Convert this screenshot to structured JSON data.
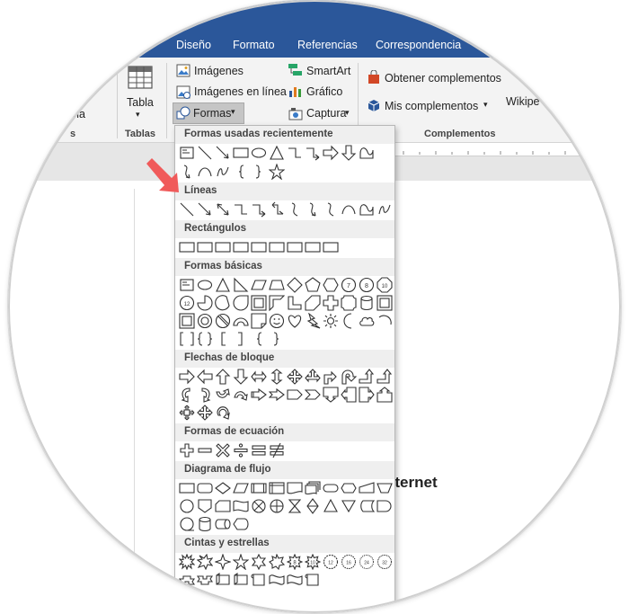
{
  "ribbon": {
    "tabs": [
      "Diseño",
      "Formato",
      "Referencias",
      "Correspondencia"
    ],
    "partial_left": "na",
    "group_left_partial": "s",
    "table_label": "Tabla",
    "table_group": "Tablas",
    "imagenes": "Imágenes",
    "imagenes_en_linea": "Imágenes en línea",
    "formas": "Formas",
    "smartart": "SmartArt",
    "grafico": "Gráfico",
    "captura": "Captura",
    "obtener_complementos": "Obtener complementos",
    "mis_complementos": "Mis complementos",
    "wikipedia_partial": "Wikipe",
    "complementos_group": "Complementos"
  },
  "document": {
    "visible_text": "nternet"
  },
  "shapes_panel": {
    "sections": [
      "Formas usadas recientemente",
      "Líneas",
      "Rectángulos",
      "Formas básicas",
      "Flechas de bloque",
      "Formas de ecuación",
      "Diagrama de flujo",
      "Cintas y estrellas"
    ]
  },
  "colors": {
    "ribbon_tab_bar": "#2b579a",
    "ribbon_bg": "#f3f3f3",
    "annotation_arrow": "#f05a5a",
    "section_header_bg": "#efefef"
  }
}
